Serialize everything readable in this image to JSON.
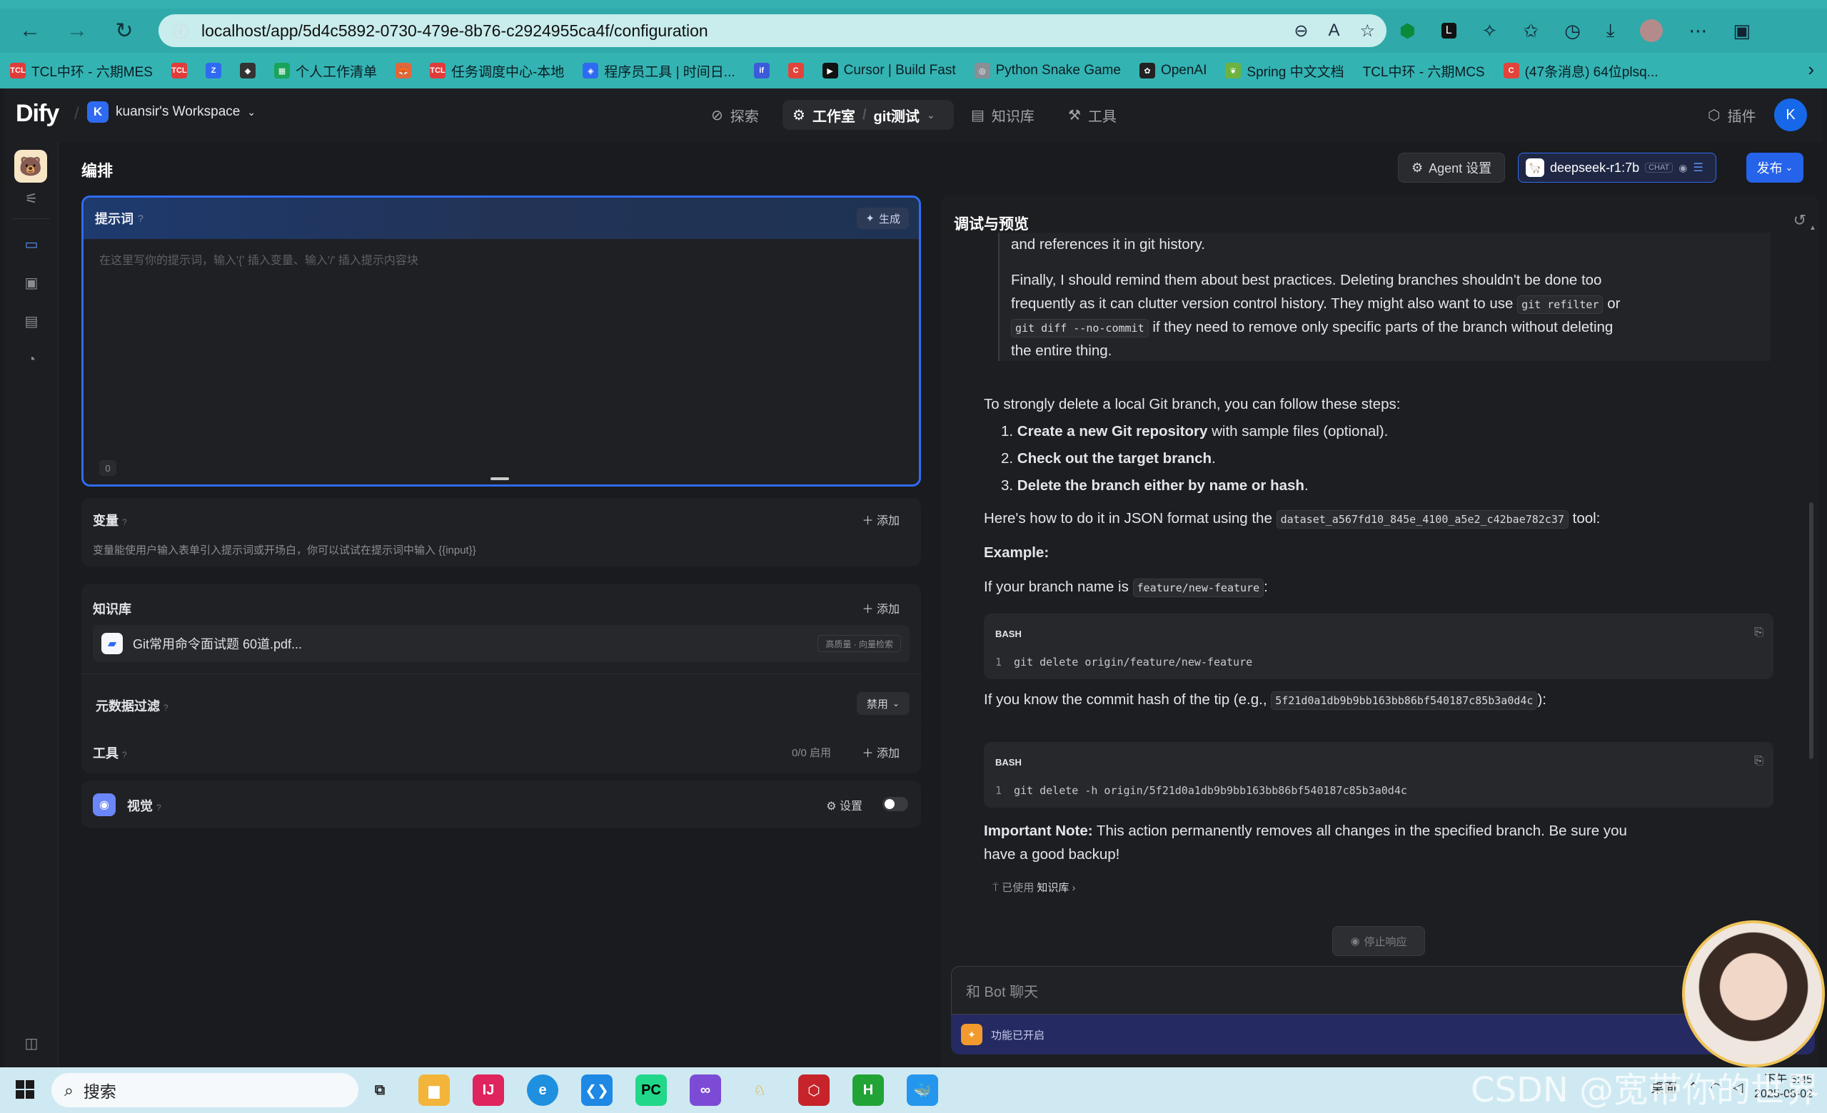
{
  "browser": {
    "url": "localhost/app/5d4c5892-0730-479e-8b76-c2924955ca4f/configuration",
    "bookmarks": [
      {
        "label": "TCL中环 - 六期MES",
        "color": "#e23b3b",
        "ic": "TCL"
      },
      {
        "label": "",
        "color": "#e23b3b",
        "ic": "TCL"
      },
      {
        "label": "",
        "color": "#2f6bf2",
        "ic": "Z"
      },
      {
        "label": "",
        "color": "#333",
        "ic": "◆"
      },
      {
        "label": "个人工作清单",
        "color": "#1aa35a",
        "ic": "▦"
      },
      {
        "label": "",
        "color": "#e2663b",
        "ic": "🦊"
      },
      {
        "label": "任务调度中心-本地",
        "color": "#e23b3b",
        "ic": "TCL"
      },
      {
        "label": "程序员工具 | 时间日...",
        "color": "#2f6bf2",
        "ic": "◈"
      },
      {
        "label": "",
        "color": "#3b5bd9",
        "ic": "if"
      },
      {
        "label": "",
        "color": "#e2443b",
        "ic": "C"
      },
      {
        "label": "Cursor | Build Fast",
        "color": "#111",
        "ic": "▶"
      },
      {
        "label": "Python Snake Game",
        "color": "#8a8f96",
        "ic": "◎"
      },
      {
        "label": "OpenAI",
        "color": "#222",
        "ic": "✿"
      },
      {
        "label": "Spring 中文文档",
        "color": "#6db33f",
        "ic": "❦"
      },
      {
        "label": "TCL中环 - 六期MCS",
        "color": "#34b3b3",
        "ic": ""
      },
      {
        "label": "(47条消息) 64位plsq...",
        "color": "#e2443b",
        "ic": "C"
      }
    ]
  },
  "app": {
    "logo": "Dify",
    "workspace_initial": "K",
    "workspace": "kuansir's Workspace",
    "nav": {
      "explore": "探索",
      "studio": "工作室",
      "app_name": "git测试",
      "knowledge": "知识库",
      "tools": "工具",
      "plugins": "插件"
    },
    "user_initial": "K",
    "page_title": "编排",
    "agent_settings": "Agent 设置",
    "model": "deepseek-r1:7b",
    "model_badge": "CHAT",
    "publish": "发布"
  },
  "prompt": {
    "title": "提示词",
    "generate": "生成",
    "placeholder": "在这里写你的提示词，输入'{' 插入变量、输入'/' 插入提示内容块",
    "count": "0"
  },
  "variables": {
    "title": "变量",
    "add": "添加",
    "desc": "变量能使用户输入表单引入提示词或开场白，你可以试试在提示词中输入 {{input}}"
  },
  "knowledge": {
    "title": "知识库",
    "add": "添加",
    "file": "Git常用命令面试题 60道.pdf...",
    "tag": "高质量 · 向量检索",
    "metadata_filter": "元数据过滤",
    "metadata_value": "禁用"
  },
  "tools": {
    "title": "工具",
    "count": "0/0 启用",
    "add": "添加"
  },
  "vision": {
    "title": "视觉",
    "settings": "设置"
  },
  "debug": {
    "title": "调试与预览",
    "think_lines": [
      "and references it in git history.",
      "Finally, I should remind them about best practices. Deleting branches shouldn't be done too",
      "frequently as it can clutter version control history. They might also want to use",
      "git refilter",
      "or",
      "git diff --no-commit",
      "if they need to remove only specific parts of the branch without deleting",
      "the entire thing."
    ],
    "intro": "To strongly delete a local Git branch, you can follow these steps:",
    "steps": [
      {
        "bold": "Create a new Git repository",
        "rest": " with sample files (optional)."
      },
      {
        "bold": "Check out the target branch",
        "rest": "."
      },
      {
        "bold": "Delete the branch either by name or hash",
        "rest": "."
      }
    ],
    "json_pre": "Here's how to do it in JSON format using the",
    "json_tool": "dataset_a567fd10_845e_4100_a5e2_c42bae782c37",
    "json_post": "tool:",
    "example": "Example:",
    "branch_pre": "If your branch name is",
    "branch_name": "feature/new-feature",
    "branch_post": ":",
    "code1_lang": "BASH",
    "code1_line": "1",
    "code1": "git delete origin/feature/new-feature",
    "hash_pre": "If you know the commit hash of the tip (e.g.,",
    "hash_val": "5f21d0a1db9b9bb163bb86bf540187c85b3a0d4c",
    "hash_post": "):",
    "code2_lang": "BASH",
    "code2_line": "1",
    "code2": "git delete -h origin/5f21d0a1db9b9bb163bb86bf540187c85b3a0d4c",
    "note_bold": "Important Note:",
    "note_rest": " This action permanently removes all changes in the specified branch. Be sure you",
    "note_rest2": "have a good backup!",
    "used_kb_pre": "已使用",
    "used_kb": "知识库",
    "stop": "停止响应",
    "input_placeholder": "和 Bot 聊天",
    "features_on": "功能已开启"
  },
  "taskbar": {
    "search": "搜索",
    "desktop": "桌面",
    "time": "下午 5:45",
    "date": "2025-08-02"
  },
  "watermark": "CSDN @宽带你的世界"
}
